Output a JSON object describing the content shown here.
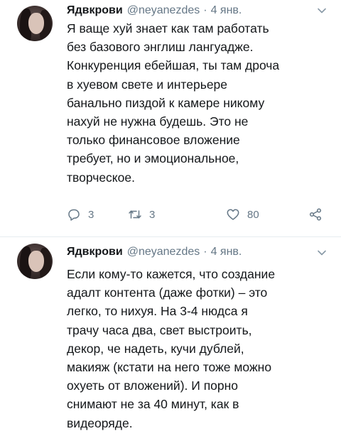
{
  "tweets": [
    {
      "author": {
        "name": "Ядвкрови",
        "handle": "@neyanezdes",
        "separator": "·",
        "time": "4 янв."
      },
      "avatar_icon": "avatar-photo",
      "menu_icon": "chevron-down-icon",
      "text": "Я ваще хуй знает как там работать\nбез базового энглиш лангуадже.\nКонкуренция ебейшая, ты там дроча\nв хуевом свете и интерьере\nбанально пиздой к камере никому\nнахуй не нужна будешь. Это не\nтолько финансовое вложение\nтребует, но и эмоциональное,\nтворческое.",
      "actions": {
        "reply_count": "3",
        "retweet_count": "3",
        "like_count": "80"
      }
    },
    {
      "author": {
        "name": "Ядвкрови",
        "handle": "@neyanezdes",
        "separator": "·",
        "time": "4 янв."
      },
      "avatar_icon": "avatar-photo",
      "menu_icon": "chevron-down-icon",
      "text": "Если кому-то кажется, что создание\nадалт контента (даже фотки) – это\nлегко, то нихуя. На 3-4 нюдса я\nтрачу часа два, свет выстроить,\nдекор, че надеть, кучи дублей,\nмакияж (кстати на него тоже можно\nохуеть от вложений). И порно\nснимают не за 40 минут, как в\nвидеоряде."
    }
  ],
  "colors": {
    "text": "#14171a",
    "secondary": "#657786",
    "divider": "#e6ecf0",
    "background": "#ffffff"
  }
}
